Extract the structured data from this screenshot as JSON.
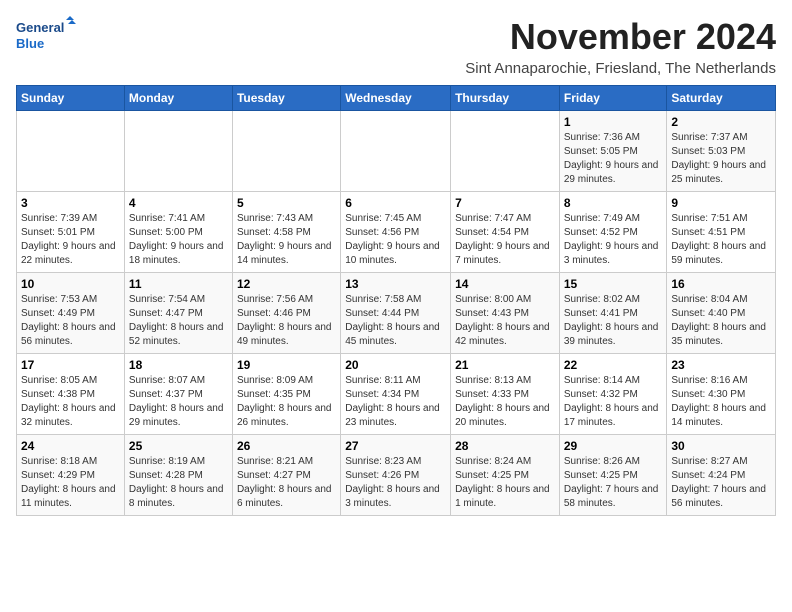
{
  "logo": {
    "line1": "General",
    "line2": "Blue"
  },
  "title": "November 2024",
  "location": "Sint Annaparochie, Friesland, The Netherlands",
  "days_header": [
    "Sunday",
    "Monday",
    "Tuesday",
    "Wednesday",
    "Thursday",
    "Friday",
    "Saturday"
  ],
  "weeks": [
    [
      {
        "day": "",
        "info": ""
      },
      {
        "day": "",
        "info": ""
      },
      {
        "day": "",
        "info": ""
      },
      {
        "day": "",
        "info": ""
      },
      {
        "day": "",
        "info": ""
      },
      {
        "day": "1",
        "info": "Sunrise: 7:36 AM\nSunset: 5:05 PM\nDaylight: 9 hours and 29 minutes."
      },
      {
        "day": "2",
        "info": "Sunrise: 7:37 AM\nSunset: 5:03 PM\nDaylight: 9 hours and 25 minutes."
      }
    ],
    [
      {
        "day": "3",
        "info": "Sunrise: 7:39 AM\nSunset: 5:01 PM\nDaylight: 9 hours and 22 minutes."
      },
      {
        "day": "4",
        "info": "Sunrise: 7:41 AM\nSunset: 5:00 PM\nDaylight: 9 hours and 18 minutes."
      },
      {
        "day": "5",
        "info": "Sunrise: 7:43 AM\nSunset: 4:58 PM\nDaylight: 9 hours and 14 minutes."
      },
      {
        "day": "6",
        "info": "Sunrise: 7:45 AM\nSunset: 4:56 PM\nDaylight: 9 hours and 10 minutes."
      },
      {
        "day": "7",
        "info": "Sunrise: 7:47 AM\nSunset: 4:54 PM\nDaylight: 9 hours and 7 minutes."
      },
      {
        "day": "8",
        "info": "Sunrise: 7:49 AM\nSunset: 4:52 PM\nDaylight: 9 hours and 3 minutes."
      },
      {
        "day": "9",
        "info": "Sunrise: 7:51 AM\nSunset: 4:51 PM\nDaylight: 8 hours and 59 minutes."
      }
    ],
    [
      {
        "day": "10",
        "info": "Sunrise: 7:53 AM\nSunset: 4:49 PM\nDaylight: 8 hours and 56 minutes."
      },
      {
        "day": "11",
        "info": "Sunrise: 7:54 AM\nSunset: 4:47 PM\nDaylight: 8 hours and 52 minutes."
      },
      {
        "day": "12",
        "info": "Sunrise: 7:56 AM\nSunset: 4:46 PM\nDaylight: 8 hours and 49 minutes."
      },
      {
        "day": "13",
        "info": "Sunrise: 7:58 AM\nSunset: 4:44 PM\nDaylight: 8 hours and 45 minutes."
      },
      {
        "day": "14",
        "info": "Sunrise: 8:00 AM\nSunset: 4:43 PM\nDaylight: 8 hours and 42 minutes."
      },
      {
        "day": "15",
        "info": "Sunrise: 8:02 AM\nSunset: 4:41 PM\nDaylight: 8 hours and 39 minutes."
      },
      {
        "day": "16",
        "info": "Sunrise: 8:04 AM\nSunset: 4:40 PM\nDaylight: 8 hours and 35 minutes."
      }
    ],
    [
      {
        "day": "17",
        "info": "Sunrise: 8:05 AM\nSunset: 4:38 PM\nDaylight: 8 hours and 32 minutes."
      },
      {
        "day": "18",
        "info": "Sunrise: 8:07 AM\nSunset: 4:37 PM\nDaylight: 8 hours and 29 minutes."
      },
      {
        "day": "19",
        "info": "Sunrise: 8:09 AM\nSunset: 4:35 PM\nDaylight: 8 hours and 26 minutes."
      },
      {
        "day": "20",
        "info": "Sunrise: 8:11 AM\nSunset: 4:34 PM\nDaylight: 8 hours and 23 minutes."
      },
      {
        "day": "21",
        "info": "Sunrise: 8:13 AM\nSunset: 4:33 PM\nDaylight: 8 hours and 20 minutes."
      },
      {
        "day": "22",
        "info": "Sunrise: 8:14 AM\nSunset: 4:32 PM\nDaylight: 8 hours and 17 minutes."
      },
      {
        "day": "23",
        "info": "Sunrise: 8:16 AM\nSunset: 4:30 PM\nDaylight: 8 hours and 14 minutes."
      }
    ],
    [
      {
        "day": "24",
        "info": "Sunrise: 8:18 AM\nSunset: 4:29 PM\nDaylight: 8 hours and 11 minutes."
      },
      {
        "day": "25",
        "info": "Sunrise: 8:19 AM\nSunset: 4:28 PM\nDaylight: 8 hours and 8 minutes."
      },
      {
        "day": "26",
        "info": "Sunrise: 8:21 AM\nSunset: 4:27 PM\nDaylight: 8 hours and 6 minutes."
      },
      {
        "day": "27",
        "info": "Sunrise: 8:23 AM\nSunset: 4:26 PM\nDaylight: 8 hours and 3 minutes."
      },
      {
        "day": "28",
        "info": "Sunrise: 8:24 AM\nSunset: 4:25 PM\nDaylight: 8 hours and 1 minute."
      },
      {
        "day": "29",
        "info": "Sunrise: 8:26 AM\nSunset: 4:25 PM\nDaylight: 7 hours and 58 minutes."
      },
      {
        "day": "30",
        "info": "Sunrise: 8:27 AM\nSunset: 4:24 PM\nDaylight: 7 hours and 56 minutes."
      }
    ]
  ]
}
